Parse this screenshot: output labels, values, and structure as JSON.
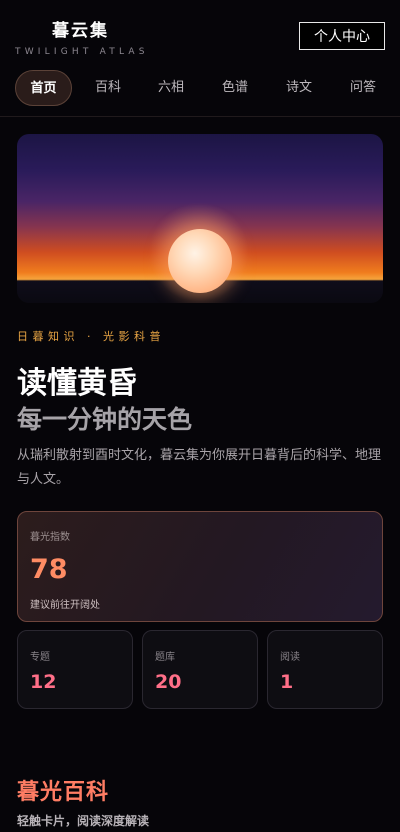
{
  "header": {
    "brand": "暮云集",
    "brand_sub": "TWILIGHT ATLAS",
    "profile_label": "个人中心"
  },
  "nav": {
    "items": [
      {
        "label": "首页",
        "active": true
      },
      {
        "label": "百科"
      },
      {
        "label": "六相"
      },
      {
        "label": "色谱"
      },
      {
        "label": "诗文"
      },
      {
        "label": "问答"
      }
    ]
  },
  "hero": {
    "eyebrow": "日暮知识 · 光影科普",
    "title_line1": "读懂黄昏",
    "title_line2": "每一分钟的天色",
    "description": "从瑞利散射到酉时文化，暮云集为你展开日暮背后的科学、地理与人文。"
  },
  "index_card": {
    "label": "暮光指数",
    "value": "78",
    "note": "建议前往开阔处"
  },
  "stats": [
    {
      "label": "专题",
      "value": "12"
    },
    {
      "label": "题库",
      "value": "20"
    },
    {
      "label": "阅读",
      "value": "1"
    }
  ],
  "section": {
    "title": "暮光百科",
    "subtitle": "轻触卡片，阅读深度解读"
  },
  "colors": {
    "accent": "#ff7d64",
    "gold": "#e9a544",
    "stat_value": "#ff6f88",
    "background": "#060509"
  }
}
